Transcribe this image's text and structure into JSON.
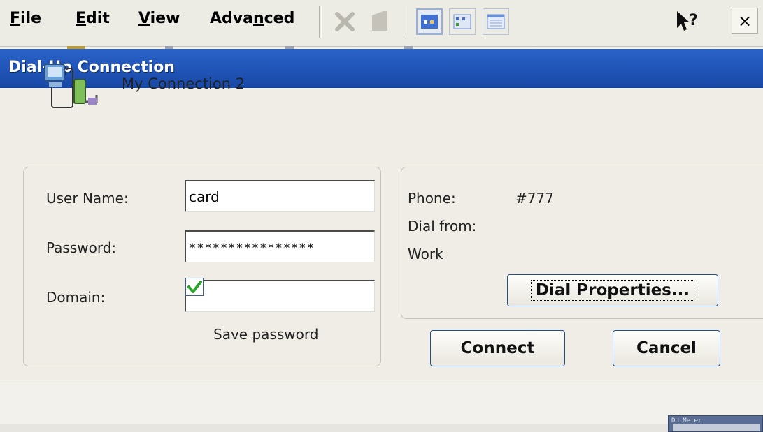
{
  "menubar": {
    "items": [
      {
        "label": "File",
        "mnemonic": "F"
      },
      {
        "label": "Edit",
        "mnemonic": "E"
      },
      {
        "label": "View",
        "mnemonic": "V"
      },
      {
        "label": "Advanced",
        "mnemonic": "n"
      }
    ],
    "toolbar_icons": [
      "delete-icon",
      "properties-icon",
      "large-icons-view-icon",
      "small-icons-view-icon",
      "details-view-icon"
    ],
    "help_icon": "help-cursor-icon",
    "close_label": "×"
  },
  "dialog": {
    "title": "Dial-Up Connection",
    "connection_name": "My Connection 2",
    "credentials": {
      "user_name_label": "User Name:",
      "user_name_value": "card",
      "password_label": "Password:",
      "password_value": "****************",
      "domain_label": "Domain:",
      "domain_value": "",
      "save_password_label": "Save password",
      "save_password_checked": true
    },
    "dial_info": {
      "phone_label": "Phone:",
      "phone_value": "#777",
      "dial_from_label": "Dial from:",
      "dial_from_value": "Work",
      "dial_properties_label": "Dial Properties..."
    },
    "connect_label": "Connect",
    "cancel_label": "Cancel"
  },
  "taskbar_thumbnail": {
    "title": "DU Meter"
  },
  "colors": {
    "titlebar": "#1f55b8",
    "button_border": "#1f4f8e",
    "check": "#2aa32a"
  }
}
